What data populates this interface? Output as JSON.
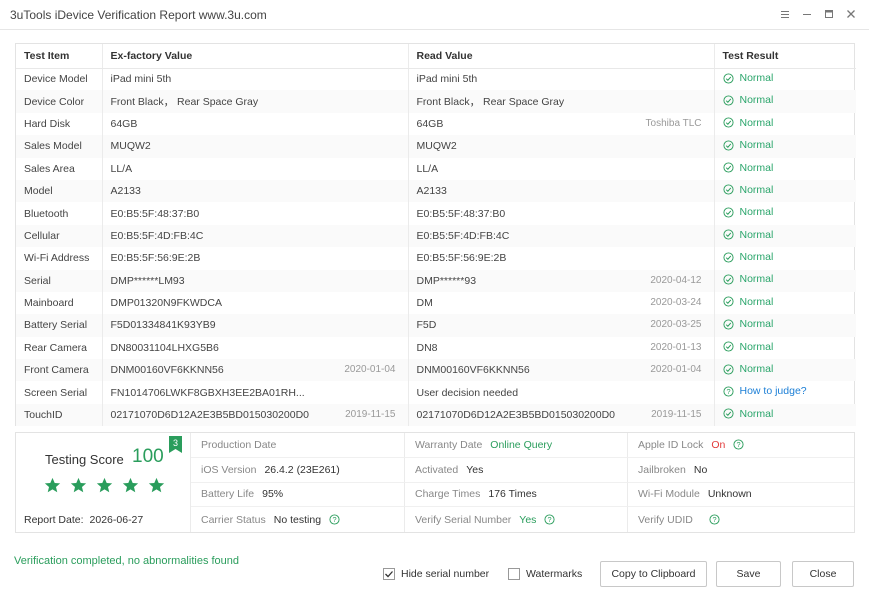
{
  "window": {
    "title": "3uTools iDevice Verification Report www.3u.com"
  },
  "table": {
    "headers": [
      "Test Item",
      "Ex-factory Value",
      "Read Value",
      "Test Result"
    ],
    "rows": [
      {
        "item": "Device Model",
        "factory": "iPad mini 5th",
        "factory_date": "",
        "read": "iPad mini 5th",
        "read_date": "",
        "result": "Normal"
      },
      {
        "item": "Device Color",
        "factory": "Front Black， Rear Space Gray",
        "factory_date": "",
        "read": "Front Black， Rear Space Gray",
        "read_date": "",
        "result": "Normal"
      },
      {
        "item": "Hard Disk",
        "factory": "64GB",
        "factory_date": "",
        "read": "64GB",
        "read_date": "Toshiba TLC",
        "result": "Normal"
      },
      {
        "item": "Sales Model",
        "factory": "MUQW2",
        "factory_date": "",
        "read": "MUQW2",
        "read_date": "",
        "result": "Normal"
      },
      {
        "item": "Sales Area",
        "factory": "LL/A",
        "factory_date": "",
        "read": "LL/A",
        "read_date": "",
        "result": "Normal"
      },
      {
        "item": "Model",
        "factory": "A2133",
        "factory_date": "",
        "read": "A2133",
        "read_date": "",
        "result": "Normal"
      },
      {
        "item": "Bluetooth",
        "factory": "E0:B5:5F:48:37:B0",
        "factory_date": "",
        "read": "E0:B5:5F:48:37:B0",
        "read_date": "",
        "result": "Normal"
      },
      {
        "item": "Cellular",
        "factory": "E0:B5:5F:4D:FB:4C",
        "factory_date": "",
        "read": "E0:B5:5F:4D:FB:4C",
        "read_date": "",
        "result": "Normal"
      },
      {
        "item": "Wi-Fi Address",
        "factory": "E0:B5:5F:56:9E:2B",
        "factory_date": "",
        "read": "E0:B5:5F:56:9E:2B",
        "read_date": "",
        "result": "Normal"
      },
      {
        "item": "Serial",
        "factory": "DMP******LM93",
        "factory_date": "",
        "read": "DMP******93",
        "read_date": "2020-04-12",
        "result": "Normal"
      },
      {
        "item": "Mainboard",
        "factory": "DMP01320N9FKWDCA",
        "factory_date": "",
        "read": "DM",
        "read_date": "2020-03-24",
        "result": "Normal"
      },
      {
        "item": "Battery Serial",
        "factory": "F5D01334841K93YB9",
        "factory_date": "",
        "read": "F5D",
        "read_date": "2020-03-25",
        "result": "Normal"
      },
      {
        "item": "Rear Camera",
        "factory": "DN80031104LHXG5B6",
        "factory_date": "",
        "read": "DN8",
        "read_date": "2020-01-13",
        "result": "Normal"
      },
      {
        "item": "Front Camera",
        "factory": "DNM00160VF6KKNN56",
        "factory_date": "2020-01-04",
        "read": "DNM00160VF6KKNN56",
        "read_date": "2020-01-04",
        "result": "Normal"
      },
      {
        "item": "Screen Serial",
        "factory": "FN1014706LWKF8GBXH3EE2BA01RH...",
        "factory_date": "",
        "read": "User decision needed",
        "read_date": "",
        "result": "How to judge?"
      },
      {
        "item": "TouchID",
        "factory": "02171070D6D12A2E3B5BD015030200D0",
        "factory_date": "2019-11-15",
        "read": "02171070D6D12A2E3B5BD015030200D0",
        "read_date": "2019-11-15",
        "result": "Normal"
      }
    ]
  },
  "score": {
    "label": "Testing Score",
    "value": "100",
    "badge": "3",
    "stars": 5,
    "report_date_label": "Report Date:",
    "report_date": "2026-06-27"
  },
  "info": {
    "production_date_label": "Production Date",
    "production_date": "",
    "ios_label": "iOS Version",
    "ios": "26.4.2 (23E261)",
    "battery_label": "Battery Life",
    "battery": "95%",
    "carrier_label": "Carrier Status",
    "carrier": "No testing",
    "warranty_label": "Warranty Date",
    "warranty": "Online Query",
    "activated_label": "Activated",
    "activated": "Yes",
    "charge_label": "Charge Times",
    "charge": "176 Times",
    "verify_serial_label": "Verify Serial Number",
    "verify_serial": "Yes",
    "appleid_label": "Apple ID Lock",
    "appleid": "On",
    "jailbroken_label": "Jailbroken",
    "jailbroken": "No",
    "wifi_module_label": "Wi-Fi Module",
    "wifi_module": "Unknown",
    "udid_label": "Verify UDID",
    "udid": ""
  },
  "footer": {
    "status": "Verification completed, no abnormalities found",
    "hide_serial_label": "Hide serial number",
    "hide_serial_checked": true,
    "watermarks_label": "Watermarks",
    "watermarks_checked": false,
    "copy_label": "Copy to Clipboard",
    "save_label": "Save",
    "close_label": "Close"
  },
  "colors": {
    "green": "#2a9d5c",
    "link": "#1c7fd6",
    "red": "#e23b3b"
  }
}
